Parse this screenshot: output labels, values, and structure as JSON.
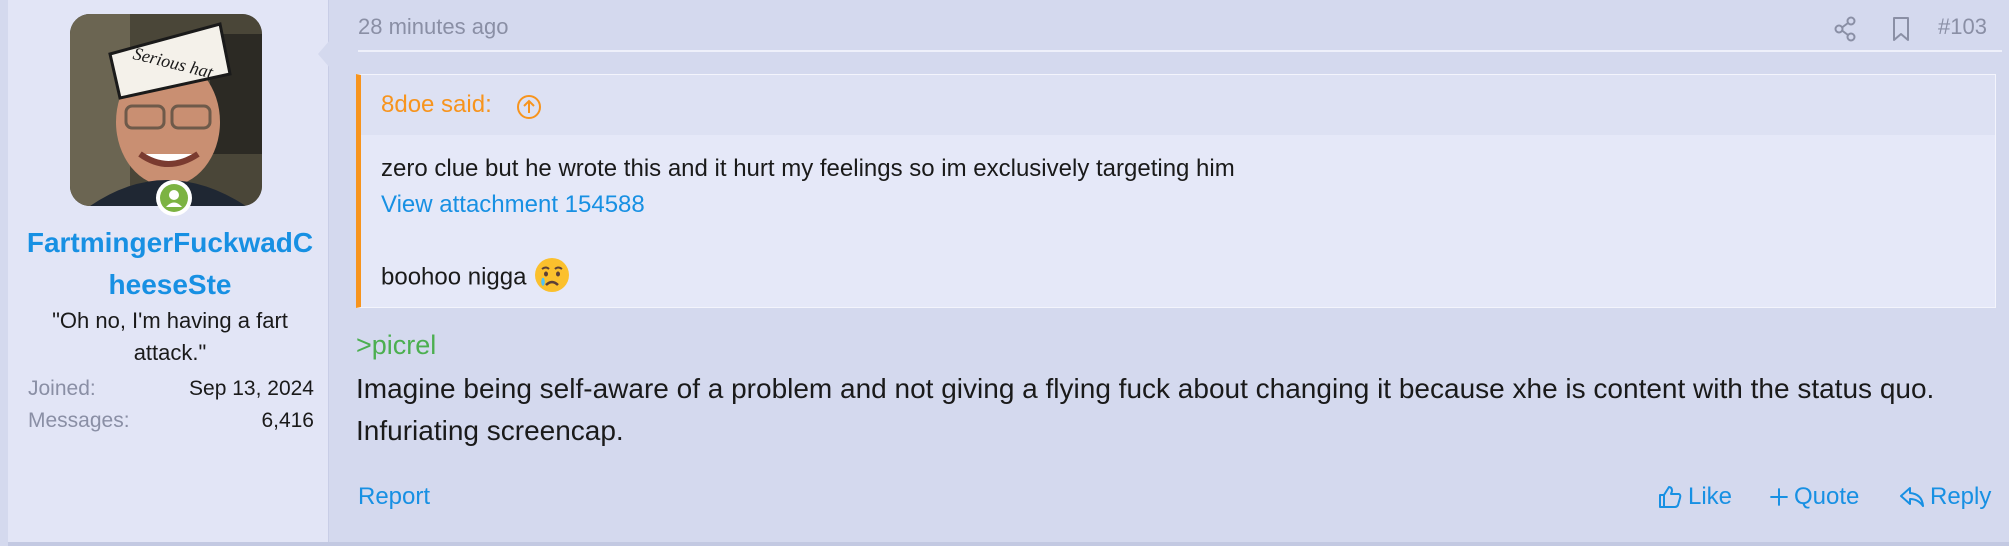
{
  "user": {
    "username": "FartmingerFuckwadCheeseSte",
    "title": "\"Oh no, I'm having a fart attack.\"",
    "hat_text": "Serious hat",
    "stats": [
      {
        "label": "Joined:",
        "value": "Sep 13, 2024"
      },
      {
        "label": "Messages:",
        "value": "6,416"
      }
    ],
    "online": true
  },
  "post": {
    "time": "28 minutes ago",
    "number": "#103",
    "quote": {
      "author": "8doe said:",
      "line1": "zero clue but he wrote this and it hurt my feelings so im exclusively targeting him",
      "attachment": "View attachment 154588",
      "line3": "boohoo nigga"
    },
    "greentext": ">picrel",
    "body": "Imagine being self-aware of a problem and not giving a flying fuck about changing it because xhe is content with the status quo. Infuriating screencap.",
    "actions": {
      "report": "Report",
      "like": "Like",
      "quote": "Quote",
      "reply": "Reply"
    }
  },
  "colors": {
    "accent": "#1790e3",
    "quote_bar": "#f7941d",
    "greentext": "#4caf50",
    "online": "#7cb342"
  },
  "icons": [
    "share-icon",
    "bookmark-icon",
    "arrow-up-circle-icon",
    "thumbs-up-icon",
    "plus-icon",
    "reply-icon",
    "crying-emoji"
  ]
}
